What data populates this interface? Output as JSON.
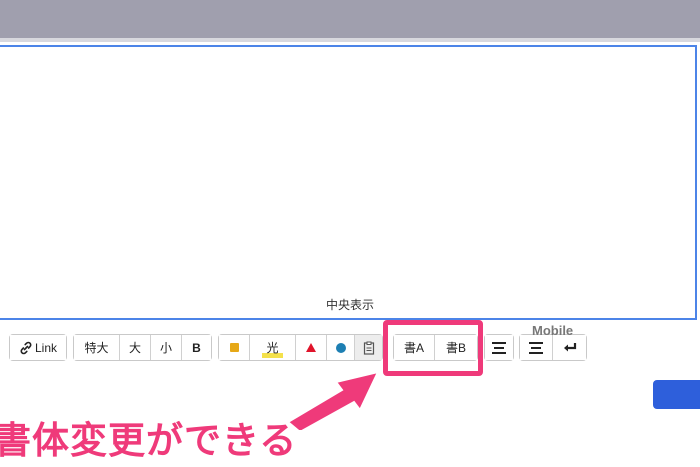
{
  "editor": {
    "center_label": "中央表示"
  },
  "toolbar": {
    "link_label": "Link",
    "size_buttons": [
      "特大",
      "大",
      "小",
      "B"
    ],
    "highlight_label": "光",
    "font_buttons": [
      "書A",
      "書B"
    ],
    "mobile_label": "Mobile"
  },
  "colors": {
    "marker_yellow": "#e6a817",
    "highlight_yellow": "#f4e14b",
    "red": "#e0142b",
    "blue": "#1d7fb3",
    "accent_pink": "#ef3a7a",
    "primary_blue": "#2e5fdb"
  },
  "annotation": {
    "callout_text": "書体変更ができる"
  }
}
